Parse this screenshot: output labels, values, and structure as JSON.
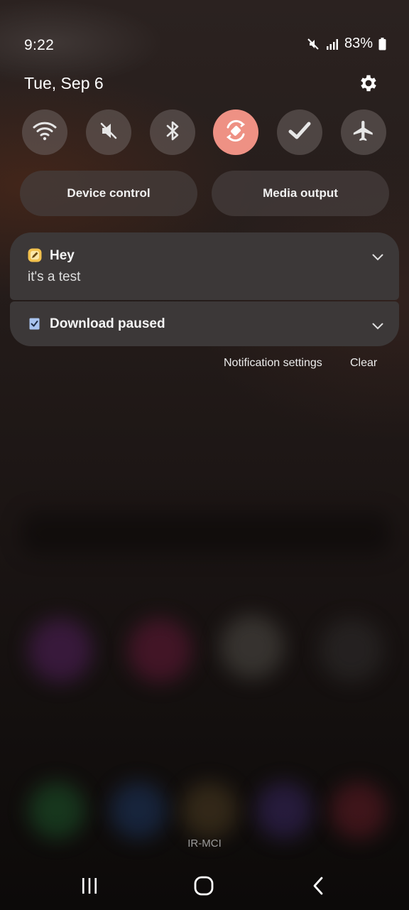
{
  "status_bar": {
    "time": "9:22",
    "battery": "83%",
    "icons": [
      "mute-icon",
      "signal-icon",
      "battery-icon"
    ]
  },
  "header": {
    "date": "Tue, Sep 6",
    "settings_icon": "gear-icon"
  },
  "quick_toggles": [
    {
      "icon": "wifi-icon",
      "active": false
    },
    {
      "icon": "sound-off-icon",
      "active": false
    },
    {
      "icon": "bluetooth-icon",
      "active": false
    },
    {
      "icon": "auto-rotate-icon",
      "active": true
    },
    {
      "icon": "check-icon",
      "active": false
    },
    {
      "icon": "airplane-icon",
      "active": false
    }
  ],
  "shortcuts": {
    "device_control": "Device control",
    "media_output": "Media output"
  },
  "notifications": [
    {
      "icon": "note-app-icon",
      "title": "Hey",
      "body": "it's a test"
    },
    {
      "icon": "download-checkbox-icon",
      "title": "Download paused"
    }
  ],
  "notification_footer": {
    "settings": "Notification settings",
    "clear": "Clear"
  },
  "carrier": "IR-MCI",
  "colors": {
    "accent_active_toggle": "#ee9184",
    "card_background": "#3c3838",
    "note_icon": "#f2c14e",
    "checkbox_icon": "#a9c4ef"
  },
  "navigation": [
    "recents-icon",
    "home-icon",
    "back-icon"
  ]
}
